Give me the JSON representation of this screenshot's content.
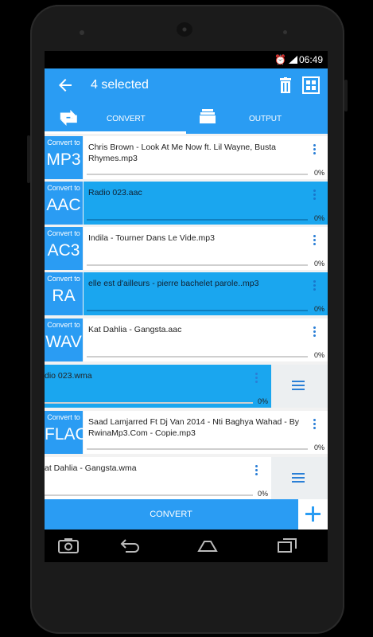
{
  "status": {
    "time": "06:49"
  },
  "appbar": {
    "title": "4 selected"
  },
  "tabs": [
    {
      "label": "CONVERT"
    },
    {
      "label": "OUTPUT"
    }
  ],
  "rows": [
    {
      "caption": "Convert to",
      "format": "MP3",
      "file": "Chris Brown - Look At Me Now ft. Lil Wayne, Busta Rhymes.mp3",
      "progress": "0%",
      "selected": false
    },
    {
      "caption": "Convert to",
      "format": "AAC",
      "file": "Radio 023.aac",
      "progress": "0%",
      "selected": true
    },
    {
      "caption": "Convert to",
      "format": "AC3",
      "file": "Indila - Tourner Dans Le Vide.mp3",
      "progress": "0%",
      "selected": false
    },
    {
      "caption": "Convert to",
      "format": "RA",
      "file": "elle est d'ailleurs - pierre bachelet parole..mp3",
      "progress": "0%",
      "selected": true
    },
    {
      "caption": "Convert to",
      "format": "WAV",
      "file": "Kat Dahlia - Gangsta.aac",
      "progress": "0%",
      "selected": false
    },
    {
      "file": "dio 023.wma",
      "progress": "0%",
      "selected": true
    },
    {
      "caption": "Convert to",
      "format": "FLAC",
      "file": "Saad Lamjarred Ft Dj Van 2014 - Nti Baghya Wahad - By RwinaMp3.Com - Copie.mp3",
      "progress": "0%",
      "selected": false
    },
    {
      "file": "at Dahlia - Gangsta.wma",
      "progress": "0%",
      "selected": false
    }
  ],
  "bottom": {
    "convert_label": "CONVERT"
  },
  "colors": {
    "accent": "#2a9cf3",
    "selected_row": "#1aa6ef"
  },
  "icons": [
    "back-arrow-icon",
    "trash-icon",
    "select-all-icon",
    "convert-swap-icon",
    "folder-stack-icon",
    "kebab-menu-icon",
    "drag-handle-icon",
    "plus-icon",
    "screenshot-icon",
    "back-icon",
    "home-icon",
    "recents-icon",
    "alarm-icon",
    "signal-icon",
    "battery-icon"
  ]
}
